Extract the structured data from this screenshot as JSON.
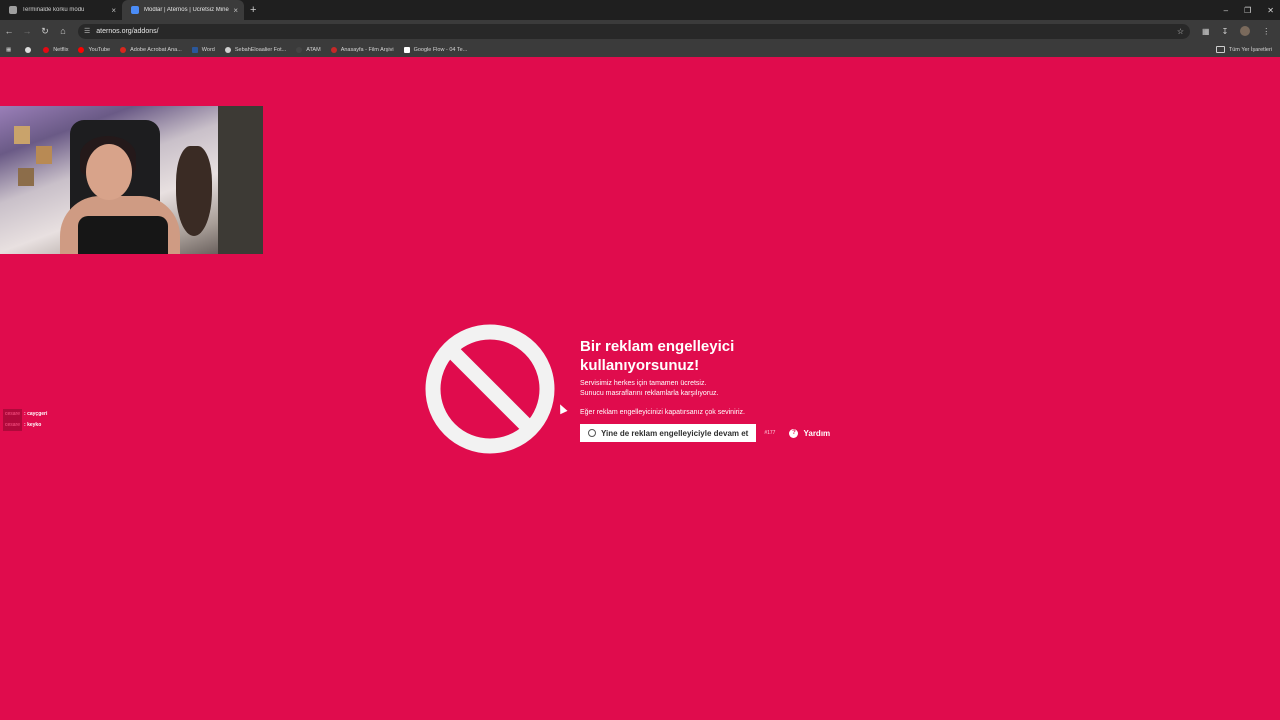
{
  "browser": {
    "tabs": [
      {
        "label": "Terminalde korku modu",
        "active": false,
        "favicon_color": "#9e9e9e"
      },
      {
        "label": "Modlar | Aternos | Ücretsiz Mine",
        "active": true,
        "favicon_color": "#4b8df8"
      }
    ],
    "new_tab_glyph": "+",
    "close_glyph": "×",
    "url": "aternos.org/addons/",
    "bookmarks": [
      {
        "label": "Netflix",
        "icon_color": "#e50914"
      },
      {
        "label": "YouTube",
        "icon_color": "#ff0000"
      },
      {
        "label": "Adobe Acrobat Ana...",
        "icon_color": "#d7261e"
      },
      {
        "label": "Word",
        "icon_color": "#2b579a"
      },
      {
        "label": "SebahEloaalier Fot...",
        "icon_color": "#d0d0d0"
      },
      {
        "label": "ATAM",
        "icon_color": "#444444"
      },
      {
        "label": "Anasayfa - Film Arşivi",
        "icon_color": "#c62828"
      },
      {
        "label": "Google Flow - 04 Te...",
        "icon_color": "#ffffff"
      }
    ],
    "all_bookmarks_label": "Tüm Yer İşaretleri"
  },
  "chat": [
    {
      "user": "cesare",
      "message": ": cayçgeri"
    },
    {
      "user": "cesare",
      "message": ": keyko"
    }
  ],
  "notice": {
    "title": "Bir reklam engelleyici kullanıyorsunuz!",
    "line1": "Servisimiz herkes için tamamen ücretsiz.",
    "line2": "Sunucu masraflarını reklamlarla karşılıyoruz.",
    "line3": "Eğer reklam engelleyicinizi kapatırsanız çok seviniriz.",
    "continue_label": "Yine de reklam engelleyiciyle devam et",
    "code": "#177",
    "help_label": "Yardım"
  },
  "colors": {
    "page_background": "#e00c4d",
    "icon": "#f2f2f2"
  }
}
